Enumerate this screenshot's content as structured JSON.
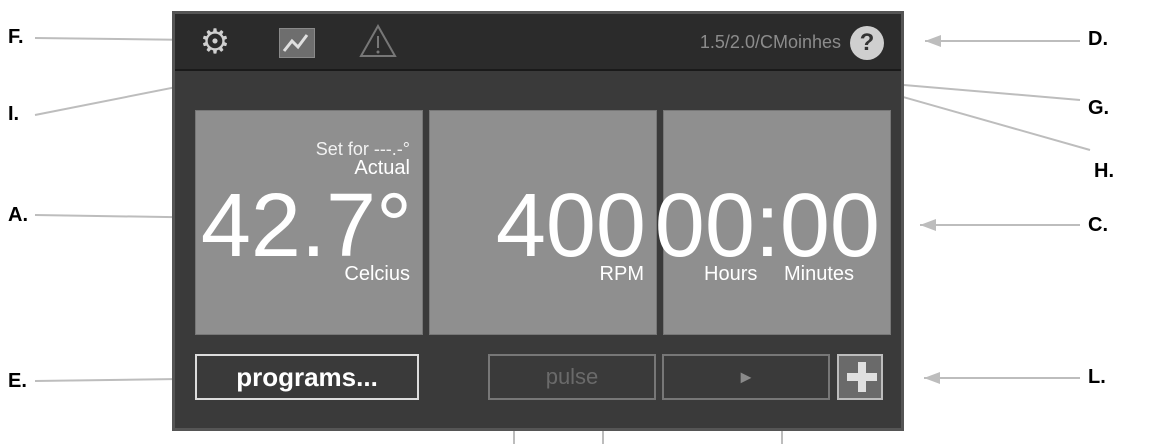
{
  "topbar": {
    "version_text": "1.5/2.0/CMoinhes",
    "help_label": "?"
  },
  "tiles": {
    "temperature": {
      "set_for": "Set for ---.-°",
      "actual": "Actual",
      "value": "42.7°",
      "unit": "Celcius"
    },
    "speed": {
      "value": "400",
      "unit": "RPM"
    },
    "timer": {
      "value": "00:00",
      "hours": "Hours",
      "minutes": "Minutes"
    }
  },
  "buttons": {
    "programs": "programs...",
    "pulse": "pulse",
    "play": "►"
  },
  "callouts": {
    "A": "A.",
    "C": "C.",
    "D": "D.",
    "E": "E.",
    "F": "F.",
    "G": "G.",
    "H": "H.",
    "I": "I.",
    "L": "L."
  },
  "icons": [
    "gear-icon",
    "trend-icon",
    "warning-icon",
    "help-icon",
    "plus-icon",
    "play-icon"
  ]
}
